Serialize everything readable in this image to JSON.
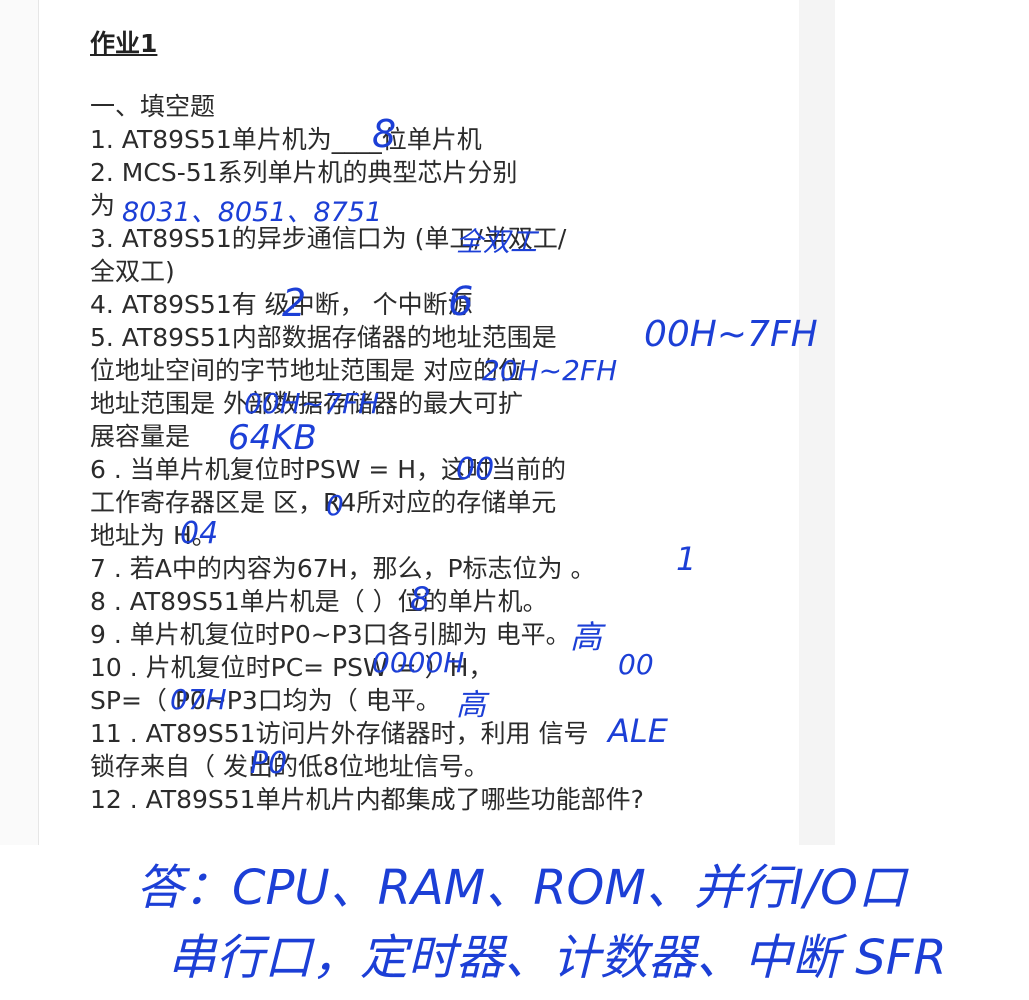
{
  "title": "作业1",
  "section": "一、填空题",
  "lines": [
    "1. AT89S51单片机为____位单片机",
    "2. MCS-51系列单片机的典型芯片分别",
    "为",
    "3. AT89S51的异步通信口为     (单工/半双工/",
    "全双工)",
    "4. AT89S51有   级中断，   个中断源",
    "5. AT89S51内部数据存储器的地址范围是",
    "位地址空间的字节地址范围是        对应的位",
    "地址范围是        外部数据存储器的最大可扩",
    "展容量是",
    "6 . 当单片机复位时PSW =      H，这时当前的",
    "工作寄存器区是       区，R4所对应的存储单元",
    "地址为    H。",
    "7 . 若A中的内容为67H，那么，P标志位为    。",
    "8 . AT89S51单片机是（   ）位的单片机。",
    "9 . 单片机复位时P0~P3口各引脚为     电平。",
    "10 . 片机复位时PC=          PSW =        ）H，",
    "SP=（        P0~P3口均为（    电平。",
    "11 . AT89S51访问片外存储器时，利用       信号",
    "锁存来自（     发出的低8位地址信号。",
    "12 . AT89S51单片机片内都集成了哪些功能部件?"
  ],
  "handwritten": {
    "q1": "8",
    "q2": "8031、8051、8751",
    "q3": "全双工",
    "q4a": "2",
    "q4b": "6",
    "q5a": "00H~7FH",
    "q5b": "20H~2FH",
    "q5c": "00H~7FH",
    "q5d": "64KB",
    "q6a": "00",
    "q6b": "0",
    "q6c": "04",
    "q7": "1",
    "q8": "8",
    "q9": "高",
    "q10a": "0000H",
    "q10b": "00",
    "q10c": "07H",
    "q10d": "高",
    "q11a": "ALE",
    "q11b": "P0",
    "answer12_line1": "答：CPU、RAM、ROM、并行I/O口",
    "answer12_line2": "串行口，定时器、计数器、中断 SFR"
  },
  "colors": {
    "ink": "#1c3fd6",
    "text": "#2b2b2b"
  }
}
